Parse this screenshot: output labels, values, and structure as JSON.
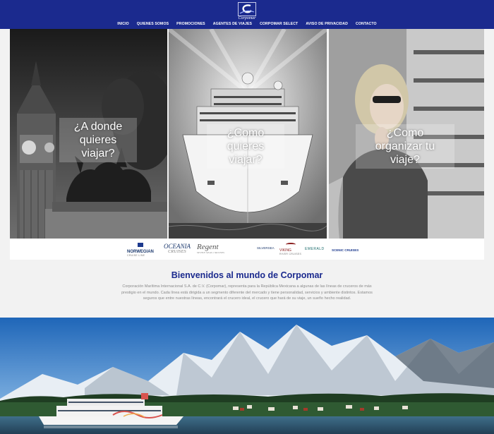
{
  "header": {
    "logo_text": "Corpomar",
    "nav": [
      "INICIO",
      "QUIENES SOMOS",
      "PROMOCIONES",
      "AGENTES DE VIAJES",
      "CORPOMAR SELECT",
      "AVISO DE PRIVACIDAD",
      "CONTACTO"
    ]
  },
  "hero": [
    {
      "line1": "¿A donde",
      "line2": "quieres viajar?"
    },
    {
      "line1": "¿Como",
      "line2": "quieres viajar?"
    },
    {
      "line1": "¿Como",
      "line2": "organizar tu viaje?"
    }
  ],
  "brands": {
    "norwegian": "NORWEGIAN",
    "norwegian_sub": "CRUISE LINE",
    "oceania": "OCEANIA",
    "oceania_sub": "CRUISES",
    "regent": "Regent",
    "regent_sub": "SEVEN SEAS CRUISES",
    "silversea": "SILVERSEA",
    "viking": "VIKING",
    "viking_sub": "RIVER CRUISES",
    "emerald": "EMERALD",
    "scenic": "SCENIC CRUISES"
  },
  "welcome": {
    "title": "Bienvenidos al mundo de Corpomar",
    "text": "Corporación Marítima Internacional S.A. de C.V. (Corpomar), representa para la República Mexicana a algunas de las líneas de cruceros de más prestigio en el mundo. Cada línea está dirigida a un segmento diferente del mercado y tiene personalidad, servicios y ambiente distintos. Estamos seguros que entre nuestras líneas, encontrará el crucero ideal, el crucero que hará de su viaje, un sueño hecho realidad."
  },
  "colors": {
    "brand_blue": "#1b2a8e",
    "background": "#f2f2f2"
  }
}
